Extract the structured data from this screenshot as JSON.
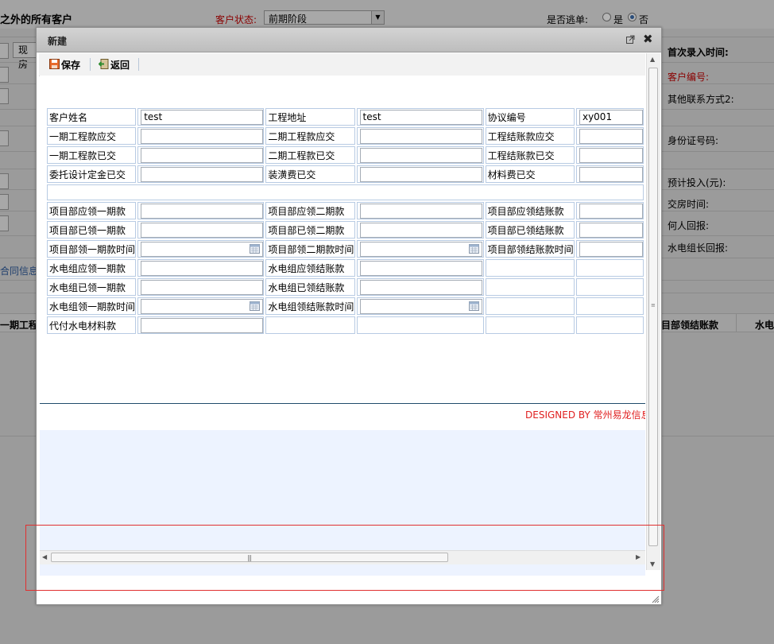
{
  "background": {
    "title": "之外的所有客户",
    "status_label": "客户状态:",
    "status_value": "前期阶段",
    "escape_label": "是否逃单:",
    "escape_yes": "是",
    "escape_no": "否",
    "xian_btn": "现房",
    "right_labels": [
      {
        "text": "首次录入时间:",
        "bold": true
      },
      {
        "text": "客户编号:",
        "red": true
      },
      {
        "text": "其他联系方式2:"
      },
      {
        "text": "身份证号码:"
      },
      {
        "text": "预计投入(元):"
      },
      {
        "text": "交房时间:"
      },
      {
        "text": "何人回报:"
      },
      {
        "text": "水电组长回报:"
      }
    ],
    "contract_link": "合同信息",
    "table_head_left": "一期工程",
    "table_head_mid": "目部领结账款",
    "table_head_right": "水电"
  },
  "dialog": {
    "title": "新建",
    "toolbar": {
      "save": "保存",
      "back": "返回"
    },
    "form": {
      "customer_name_label": "客户姓名",
      "customer_name_value": "test",
      "project_address_label": "工程地址",
      "project_address_value": "test",
      "agreement_no_label": "协议编号",
      "agreement_no_value": "xy001",
      "rows_a": [
        [
          "一期工程款应交",
          "二期工程款应交",
          "工程结账款应交"
        ],
        [
          "一期工程款已交",
          "二期工程款已交",
          "工程结账款已交"
        ],
        [
          "委托设计定金已交",
          "装潢费已交",
          "材料费已交"
        ]
      ],
      "rows_b": [
        [
          "项目部应领一期款",
          "项目部应领二期款",
          "项目部应领结账款"
        ],
        [
          "项目部已领一期款",
          "项目部已领二期款",
          "项目部已领结账款"
        ],
        [
          "项目部领一期款时间",
          "项目部领二期款时间",
          "项目部领结账款时间"
        ]
      ],
      "rows_c": [
        [
          "水电组应领一期款",
          "水电组应领结账款"
        ],
        [
          "水电组已领一期款",
          "水电组已领结账款"
        ],
        [
          "水电组领一期款时间",
          "水电组领结账款时间"
        ]
      ],
      "last_label": "代付水电材料款"
    },
    "footer": "DESIGNED BY 常州易龙信息"
  }
}
